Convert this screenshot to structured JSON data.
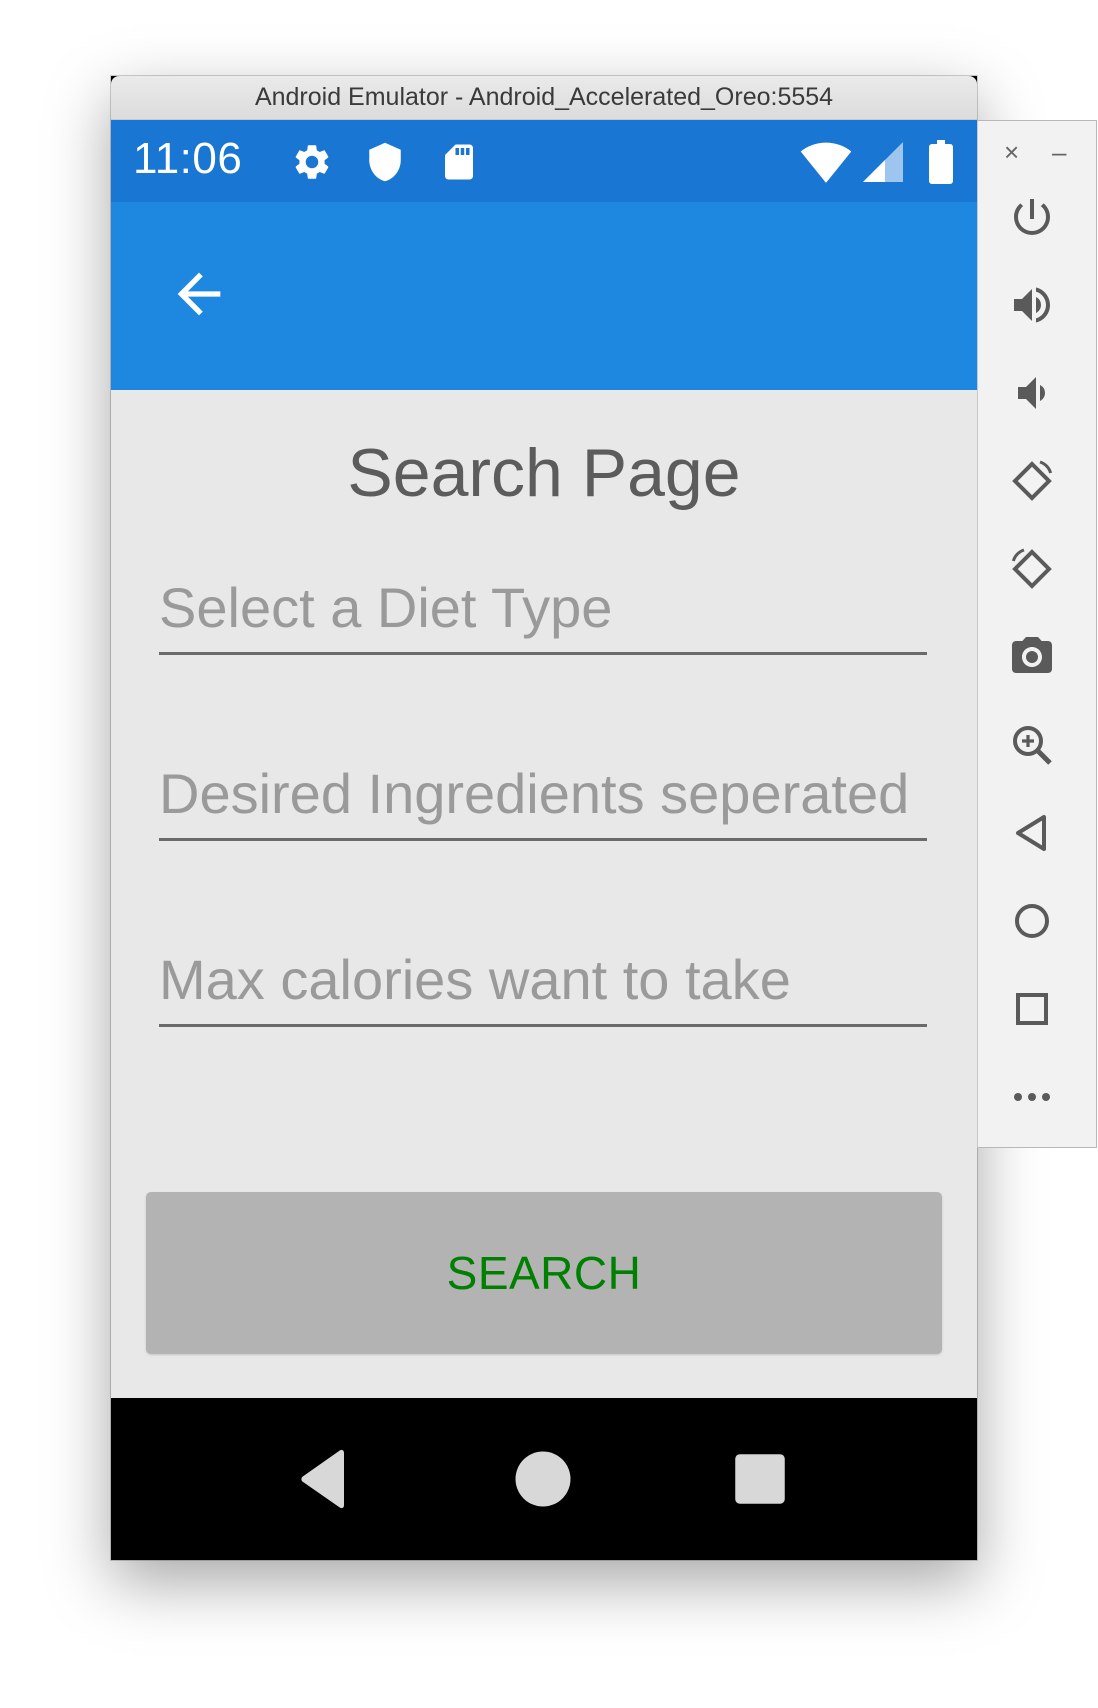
{
  "window": {
    "title": "Android Emulator - Android_Accelerated_Oreo:5554"
  },
  "status_bar": {
    "time": "11:06",
    "icons": [
      "gear-icon",
      "shield-icon",
      "sd-card-icon",
      "wifi-icon",
      "signal-icon",
      "battery-icon"
    ]
  },
  "app_bar": {
    "back_icon": "arrow-left-icon"
  },
  "page": {
    "title": "Search Page",
    "diet_field": {
      "placeholder": "Select a Diet Type",
      "value": ""
    },
    "ingredients_field": {
      "placeholder": "Desired Ingredients seperated by comma",
      "value": ""
    },
    "calories_field": {
      "placeholder": "Max calories want to take",
      "value": ""
    },
    "search_button": "SEARCH"
  },
  "nav_bar": {
    "buttons": [
      "back-triangle-icon",
      "home-circle-icon",
      "recents-square-icon"
    ]
  },
  "emulator_toolbar": {
    "close": "×",
    "minimize": "–",
    "buttons": [
      "power-icon",
      "volume-up-icon",
      "volume-down-icon",
      "rotate-left-icon",
      "rotate-right-icon",
      "camera-icon",
      "zoom-icon",
      "back-icon",
      "home-icon",
      "overview-icon",
      "more-icon"
    ]
  },
  "colors": {
    "status_bar": "#1976d2",
    "app_bar": "#1e88e0",
    "background": "#e8e8e8",
    "button": "#b3b3b3",
    "button_text": "#008000"
  }
}
